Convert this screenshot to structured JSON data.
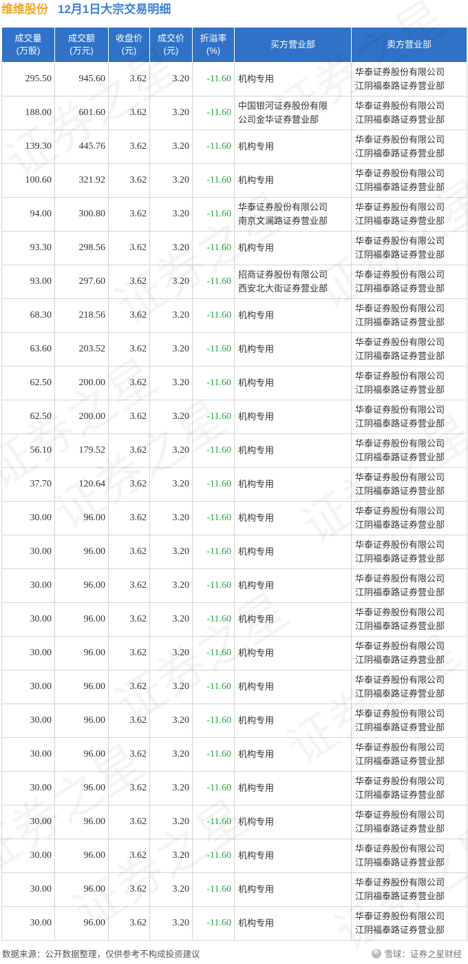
{
  "header": {
    "stock_name": "维维股份",
    "title": "12月1日大宗交易明细"
  },
  "columns": [
    [
      "成交量",
      "(万股)"
    ],
    [
      "成交额",
      "(万元)"
    ],
    [
      "收盘价",
      "(元)"
    ],
    [
      "成交价",
      "(元)"
    ],
    [
      "折溢率",
      "(%)"
    ],
    [
      "买方营业部"
    ],
    [
      "卖方营业部"
    ]
  ],
  "rows": [
    {
      "volume": "295.50",
      "amount": "945.60",
      "close": "3.62",
      "price": "3.20",
      "premium": "-11.60",
      "buyer": [
        "机构专用"
      ],
      "seller": [
        "华泰证券股份有限公司",
        "江阴福泰路证券营业部"
      ]
    },
    {
      "volume": "188.00",
      "amount": "601.60",
      "close": "3.62",
      "price": "3.20",
      "premium": "-11.60",
      "buyer": [
        "中国银河证券股份有限",
        "公司金华证券营业部"
      ],
      "seller": [
        "华泰证券股份有限公司",
        "江阴福泰路证券营业部"
      ]
    },
    {
      "volume": "139.30",
      "amount": "445.76",
      "close": "3.62",
      "price": "3.20",
      "premium": "-11.60",
      "buyer": [
        "机构专用"
      ],
      "seller": [
        "华泰证券股份有限公司",
        "江阴福泰路证券营业部"
      ]
    },
    {
      "volume": "100.60",
      "amount": "321.92",
      "close": "3.62",
      "price": "3.20",
      "premium": "-11.60",
      "buyer": [
        "机构专用"
      ],
      "seller": [
        "华泰证券股份有限公司",
        "江阴福泰路证券营业部"
      ]
    },
    {
      "volume": "94.00",
      "amount": "300.80",
      "close": "3.62",
      "price": "3.20",
      "premium": "-11.60",
      "buyer": [
        "华泰证券股份有限公司",
        "南京文澜路证券营业部"
      ],
      "seller": [
        "华泰证券股份有限公司",
        "江阴福泰路证券营业部"
      ]
    },
    {
      "volume": "93.30",
      "amount": "298.56",
      "close": "3.62",
      "price": "3.20",
      "premium": "-11.60",
      "buyer": [
        "机构专用"
      ],
      "seller": [
        "华泰证券股份有限公司",
        "江阴福泰路证券营业部"
      ]
    },
    {
      "volume": "93.00",
      "amount": "297.60",
      "close": "3.62",
      "price": "3.20",
      "premium": "-11.60",
      "buyer": [
        "招商证券股份有限公司",
        "西安北大街证券营业部"
      ],
      "seller": [
        "华泰证券股份有限公司",
        "江阴福泰路证券营业部"
      ]
    },
    {
      "volume": "68.30",
      "amount": "218.56",
      "close": "3.62",
      "price": "3.20",
      "premium": "-11.60",
      "buyer": [
        "机构专用"
      ],
      "seller": [
        "华泰证券股份有限公司",
        "江阴福泰路证券营业部"
      ]
    },
    {
      "volume": "63.60",
      "amount": "203.52",
      "close": "3.62",
      "price": "3.20",
      "premium": "-11.60",
      "buyer": [
        "机构专用"
      ],
      "seller": [
        "华泰证券股份有限公司",
        "江阴福泰路证券营业部"
      ]
    },
    {
      "volume": "62.50",
      "amount": "200.00",
      "close": "3.62",
      "price": "3.20",
      "premium": "-11.60",
      "buyer": [
        "机构专用"
      ],
      "seller": [
        "华泰证券股份有限公司",
        "江阴福泰路证券营业部"
      ]
    },
    {
      "volume": "62.50",
      "amount": "200.00",
      "close": "3.62",
      "price": "3.20",
      "premium": "-11.60",
      "buyer": [
        "机构专用"
      ],
      "seller": [
        "华泰证券股份有限公司",
        "江阴福泰路证券营业部"
      ]
    },
    {
      "volume": "56.10",
      "amount": "179.52",
      "close": "3.62",
      "price": "3.20",
      "premium": "-11.60",
      "buyer": [
        "机构专用"
      ],
      "seller": [
        "华泰证券股份有限公司",
        "江阴福泰路证券营业部"
      ]
    },
    {
      "volume": "37.70",
      "amount": "120.64",
      "close": "3.62",
      "price": "3.20",
      "premium": "-11.60",
      "buyer": [
        "机构专用"
      ],
      "seller": [
        "华泰证券股份有限公司",
        "江阴福泰路证券营业部"
      ]
    },
    {
      "volume": "30.00",
      "amount": "96.00",
      "close": "3.62",
      "price": "3.20",
      "premium": "-11.60",
      "buyer": [
        "机构专用"
      ],
      "seller": [
        "华泰证券股份有限公司",
        "江阴福泰路证券营业部"
      ]
    },
    {
      "volume": "30.00",
      "amount": "96.00",
      "close": "3.62",
      "price": "3.20",
      "premium": "-11.60",
      "buyer": [
        "机构专用"
      ],
      "seller": [
        "华泰证券股份有限公司",
        "江阴福泰路证券营业部"
      ]
    },
    {
      "volume": "30.00",
      "amount": "96.00",
      "close": "3.62",
      "price": "3.20",
      "premium": "-11.60",
      "buyer": [
        "机构专用"
      ],
      "seller": [
        "华泰证券股份有限公司",
        "江阴福泰路证券营业部"
      ]
    },
    {
      "volume": "30.00",
      "amount": "96.00",
      "close": "3.62",
      "price": "3.20",
      "premium": "-11.60",
      "buyer": [
        "机构专用"
      ],
      "seller": [
        "华泰证券股份有限公司",
        "江阴福泰路证券营业部"
      ]
    },
    {
      "volume": "30.00",
      "amount": "96.00",
      "close": "3.62",
      "price": "3.20",
      "premium": "-11.60",
      "buyer": [
        "机构专用"
      ],
      "seller": [
        "华泰证券股份有限公司",
        "江阴福泰路证券营业部"
      ]
    },
    {
      "volume": "30.00",
      "amount": "96.00",
      "close": "3.62",
      "price": "3.20",
      "premium": "-11.60",
      "buyer": [
        "机构专用"
      ],
      "seller": [
        "华泰证券股份有限公司",
        "江阴福泰路证券营业部"
      ]
    },
    {
      "volume": "30.00",
      "amount": "96.00",
      "close": "3.62",
      "price": "3.20",
      "premium": "-11.60",
      "buyer": [
        "机构专用"
      ],
      "seller": [
        "华泰证券股份有限公司",
        "江阴福泰路证券营业部"
      ]
    },
    {
      "volume": "30.00",
      "amount": "96.00",
      "close": "3.62",
      "price": "3.20",
      "premium": "-11.60",
      "buyer": [
        "机构专用"
      ],
      "seller": [
        "华泰证券股份有限公司",
        "江阴福泰路证券营业部"
      ]
    },
    {
      "volume": "30.00",
      "amount": "96.00",
      "close": "3.62",
      "price": "3.20",
      "premium": "-11.60",
      "buyer": [
        "机构专用"
      ],
      "seller": [
        "华泰证券股份有限公司",
        "江阴福泰路证券营业部"
      ]
    },
    {
      "volume": "30.00",
      "amount": "96.00",
      "close": "3.62",
      "price": "3.20",
      "premium": "-11.60",
      "buyer": [
        "机构专用"
      ],
      "seller": [
        "华泰证券股份有限公司",
        "江阴福泰路证券营业部"
      ]
    },
    {
      "volume": "30.00",
      "amount": "96.00",
      "close": "3.62",
      "price": "3.20",
      "premium": "-11.60",
      "buyer": [
        "机构专用"
      ],
      "seller": [
        "华泰证券股份有限公司",
        "江阴福泰路证券营业部"
      ]
    },
    {
      "volume": "30.00",
      "amount": "96.00",
      "close": "3.62",
      "price": "3.20",
      "premium": "-11.60",
      "buyer": [
        "机构专用"
      ],
      "seller": [
        "华泰证券股份有限公司",
        "江阴福泰路证券营业部"
      ]
    },
    {
      "volume": "30.00",
      "amount": "96.00",
      "close": "3.62",
      "price": "3.20",
      "premium": "-11.60",
      "buyer": [
        "机构专用"
      ],
      "seller": [
        "华泰证券股份有限公司",
        "江阴福泰路证券营业部"
      ]
    }
  ],
  "footer": {
    "source": "数据来源：公开数据整理，仅供参考不构成投资建议",
    "brand": "雪球：证券之星财经"
  },
  "watermark": {
    "text": "证券之星"
  },
  "colors": {
    "header_bg": "#2f72c7",
    "title_blue": "#3a7fd5",
    "stock_orange": "#f5a623",
    "negative_green": "#22a53a"
  }
}
